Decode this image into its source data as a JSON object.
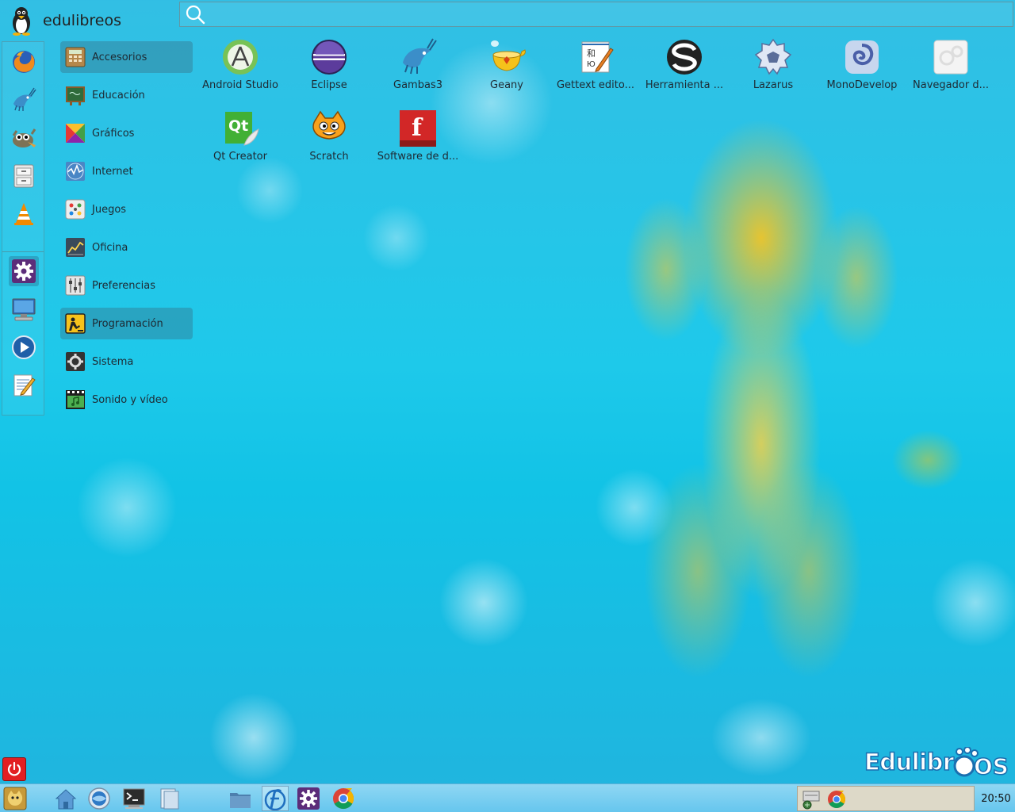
{
  "user": {
    "name": "edulibreos"
  },
  "search": {
    "placeholder": ""
  },
  "dock": {
    "items": [
      {
        "icon": "firefox-icon"
      },
      {
        "icon": "gambas-icon"
      },
      {
        "icon": "gimp-icon"
      },
      {
        "icon": "file-cabinet-icon"
      },
      {
        "icon": "vlc-icon"
      },
      {
        "icon": "settings-icon"
      },
      {
        "icon": "computer-icon"
      },
      {
        "icon": "media-player-icon"
      },
      {
        "icon": "text-editor-icon"
      }
    ]
  },
  "categories": [
    {
      "label": "Accesorios",
      "icon": "accessories-icon",
      "selected": true
    },
    {
      "label": "Educación",
      "icon": "education-icon"
    },
    {
      "label": "Gráficos",
      "icon": "graphics-icon"
    },
    {
      "label": "Internet",
      "icon": "internet-icon"
    },
    {
      "label": "Juegos",
      "icon": "games-icon"
    },
    {
      "label": "Oficina",
      "icon": "office-icon"
    },
    {
      "label": "Preferencias",
      "icon": "preferences-icon"
    },
    {
      "label": "Programación",
      "icon": "programming-icon",
      "selected": true
    },
    {
      "label": "Sistema",
      "icon": "system-icon"
    },
    {
      "label": "Sonido y vídeo",
      "icon": "sound-video-icon"
    }
  ],
  "apps": [
    {
      "label": "Android Studio",
      "icon": "android-studio-icon"
    },
    {
      "label": "Eclipse",
      "icon": "eclipse-icon"
    },
    {
      "label": "Gambas3",
      "icon": "gambas-icon"
    },
    {
      "label": "Geany",
      "icon": "geany-icon"
    },
    {
      "label": "Gettext edito...",
      "icon": "gettext-icon"
    },
    {
      "label": "Herramienta ...",
      "icon": "tool-icon"
    },
    {
      "label": "Lazarus",
      "icon": "lazarus-icon"
    },
    {
      "label": "MonoDevelop",
      "icon": "monodevelop-icon"
    },
    {
      "label": "Navegador d...",
      "icon": "browser-icon"
    },
    {
      "label": "Qt Creator",
      "icon": "qt-creator-icon"
    },
    {
      "label": "Scratch",
      "icon": "scratch-icon"
    },
    {
      "label": "Software de d...",
      "icon": "fritzing-icon"
    }
  ],
  "brand": {
    "text": "Edulibre",
    "suffix": "OS"
  },
  "taskbar": {
    "items": [
      {
        "icon": "start-menu-icon"
      },
      {
        "icon": "home-icon"
      },
      {
        "icon": "internet-icon"
      },
      {
        "icon": "terminal-icon"
      },
      {
        "icon": "document-icon"
      },
      {
        "icon": "folder-icon"
      },
      {
        "icon": "app-installer-icon"
      },
      {
        "icon": "settings-icon"
      },
      {
        "icon": "chrome-icon"
      }
    ],
    "tray": [
      "network-icon",
      "chrome-icon"
    ],
    "clock": "20:50"
  },
  "colors": {
    "accent": "#4a2a6e",
    "power": "#e21f22",
    "taskbar": "#78cdf0"
  }
}
